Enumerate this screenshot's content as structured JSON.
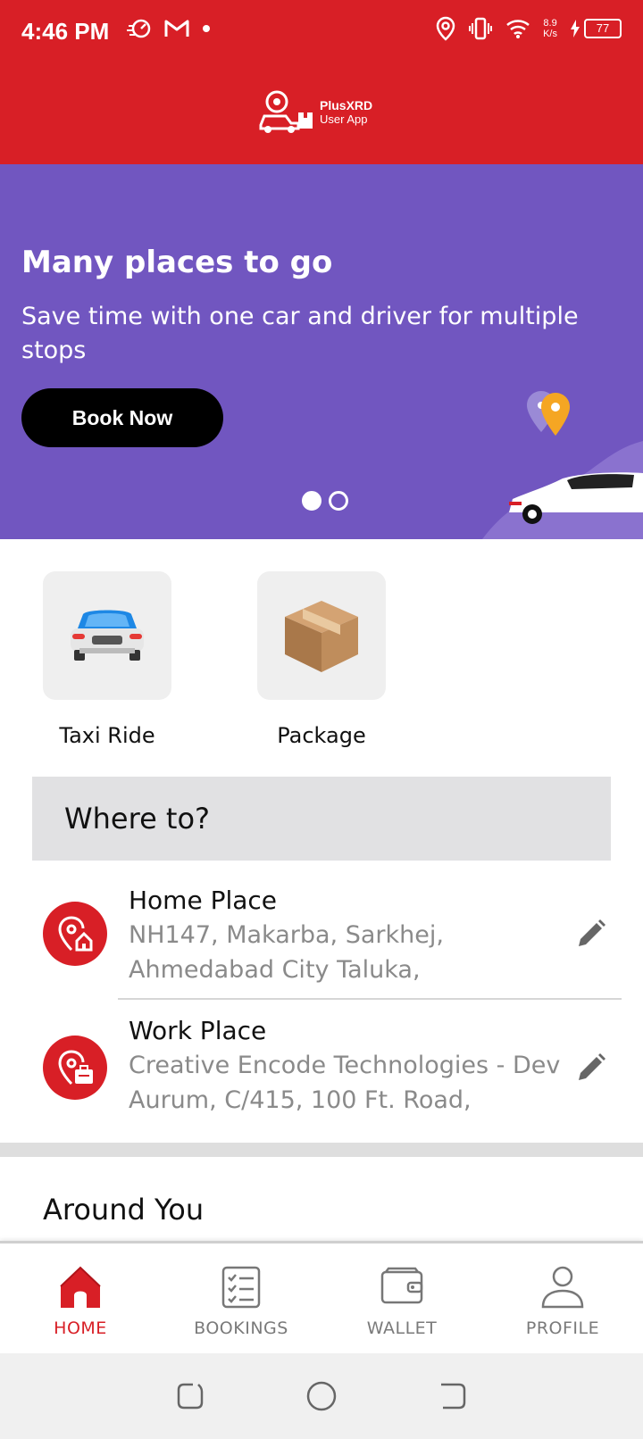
{
  "status_bar": {
    "time": "4:46 PM",
    "net_speed_value": "8.9",
    "net_speed_unit": "K/s",
    "battery": "77",
    "icons": [
      "speed-icon",
      "gmail-icon",
      "dot-icon",
      "location-icon",
      "vibrate-icon",
      "wifi-icon",
      "charging-icon"
    ]
  },
  "app": {
    "logo_name": "PlusXRD",
    "logo_sub": "User App"
  },
  "banner": {
    "title": "Many places to go",
    "subtitle": "Save time with one car and driver for multiple stops",
    "button_label": "Book Now",
    "page_count": 2,
    "active_page": 1
  },
  "services": [
    {
      "label": "Taxi Ride",
      "icon": "car-icon"
    },
    {
      "label": "Package",
      "icon": "package-box-icon"
    }
  ],
  "search": {
    "placeholder": "Where to?"
  },
  "places": [
    {
      "title": "Home Place",
      "address_line1": "NH147, Makarba, Sarkhej,",
      "address_line2": "Ahmedabad City Taluka,",
      "icon": "home-location-icon"
    },
    {
      "title": "Work Place",
      "address_line1": "Creative Encode Technologies - Dev",
      "address_line2": "Aurum, C/415, 100 Ft. Road,",
      "icon": "work-location-icon"
    }
  ],
  "section": {
    "around_title": "Around You"
  },
  "bottom_nav": [
    {
      "label": "HOME",
      "icon": "home-icon",
      "active": true
    },
    {
      "label": "BOOKINGS",
      "icon": "bookings-list-icon",
      "active": false
    },
    {
      "label": "WALLET",
      "icon": "wallet-icon",
      "active": false
    },
    {
      "label": "PROFILE",
      "icon": "profile-icon",
      "active": false
    }
  ],
  "colors": {
    "primary_red": "#d81f26",
    "banner_purple": "#7156c0",
    "inactive_grey": "#7a7a7a"
  }
}
